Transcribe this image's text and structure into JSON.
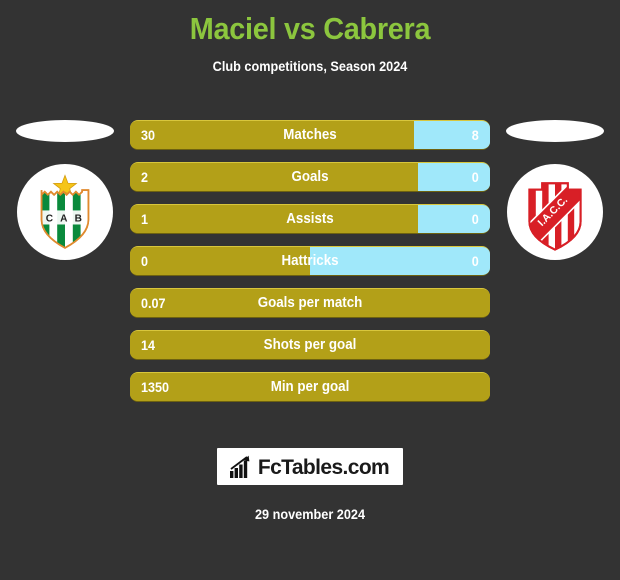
{
  "header": {
    "title": "Maciel vs Cabrera",
    "subtitle": "Club competitions, Season 2024",
    "title_color": "#8cc63e"
  },
  "colors": {
    "background": "#333333",
    "home_bar": "#b3a018",
    "away_bar": "#a0e8fa",
    "text": "#ffffff"
  },
  "home_team": {
    "crest_name": "club-atletico-banfield-crest",
    "crest_initials": "C A B",
    "primary": "#0a8a3c",
    "secondary": "#ffffff"
  },
  "away_team": {
    "crest_name": "instituto-atletico-central-cordoba-crest",
    "crest_initials": "I.A.C.C.",
    "primary": "#d81f26",
    "secondary": "#ffffff"
  },
  "stats": [
    {
      "label": "Matches",
      "home": "30",
      "away": "8",
      "home_pct": 79,
      "two_sided": true
    },
    {
      "label": "Goals",
      "home": "2",
      "away": "0",
      "home_pct": 80,
      "two_sided": true
    },
    {
      "label": "Assists",
      "home": "1",
      "away": "0",
      "home_pct": 80,
      "two_sided": true
    },
    {
      "label": "Hattricks",
      "home": "0",
      "away": "0",
      "home_pct": 50,
      "two_sided": true
    },
    {
      "label": "Goals per match",
      "home": "0.07",
      "away": "",
      "home_pct": 100,
      "two_sided": false
    },
    {
      "label": "Shots per goal",
      "home": "14",
      "away": "",
      "home_pct": 100,
      "two_sided": false
    },
    {
      "label": "Min per goal",
      "home": "1350",
      "away": "",
      "home_pct": 100,
      "two_sided": false
    }
  ],
  "footer": {
    "brand": "FcTables.com",
    "brand_icon": "bar-chart-icon",
    "date": "29 november 2024"
  }
}
